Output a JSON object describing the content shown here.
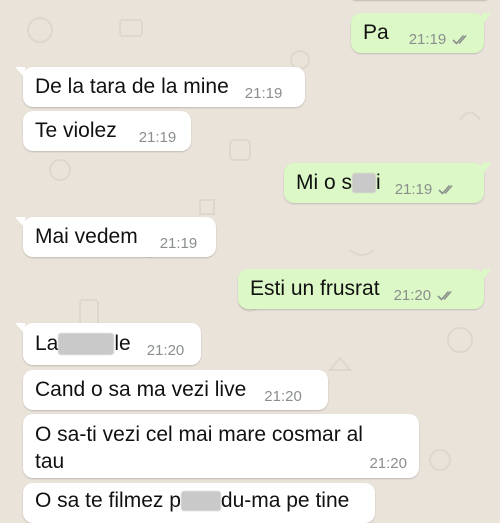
{
  "colors": {
    "incoming_bubble": "#ffffff",
    "outgoing_bubble": "#dcf8c6",
    "chat_background": "#e9e3da",
    "timestamp": "#8a8f8c",
    "read_ticks": "#8a8f8c"
  },
  "messages": [
    {
      "direction": "out",
      "text": "Pa",
      "time": "21:19",
      "status": "delivered-double-tick"
    },
    {
      "direction": "in",
      "text": "De la tara de la mine",
      "time": "21:19"
    },
    {
      "direction": "in",
      "text": "Te violez",
      "time": "21:19"
    },
    {
      "direction": "out",
      "text_before": "Mi o s",
      "text_after": "i",
      "time": "21:19",
      "status": "delivered-double-tick",
      "redacted": true
    },
    {
      "direction": "in",
      "text": "Mai vedem",
      "time": "21:19"
    },
    {
      "direction": "out",
      "text": "Esti un frusrat",
      "time": "21:20",
      "status": "delivered-double-tick"
    },
    {
      "direction": "in",
      "text_before": "La",
      "text_after": "le",
      "time": "21:20",
      "redacted": true
    },
    {
      "direction": "in",
      "text": "Cand o sa ma vezi live",
      "time": "21:20"
    },
    {
      "direction": "in",
      "text": "O sa-ti vezi cel mai mare cosmar al tau",
      "time": "21:20"
    },
    {
      "direction": "in",
      "text_before": "O sa te filmez p",
      "text_after": "du-ma pe tine",
      "redacted": true,
      "partially_visible": true
    }
  ]
}
